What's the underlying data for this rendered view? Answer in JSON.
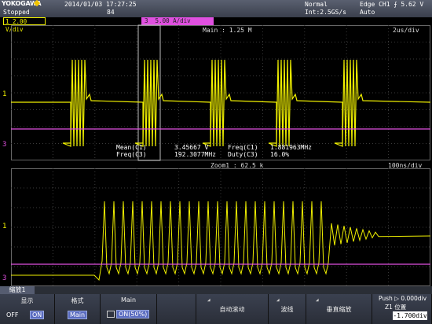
{
  "header": {
    "brand": "YOKOGAWA",
    "status": "Stopped",
    "datetime": "2014/01/03  17:27:25",
    "counter": "84",
    "mode": "Normal",
    "sampling": "Int:2.5GS/s",
    "trigger": "Edge CH1  ⨍  5.62 V",
    "acquisition": "Auto"
  },
  "channels": {
    "ch1": {
      "label": "2.00 V/div",
      "number": "1",
      "color": "#f0f000"
    },
    "ch3": {
      "label": "5.00 A/div",
      "number": "3",
      "color": "#e050e0"
    }
  },
  "main_window": {
    "title": "Main : 1.25 M",
    "timebase": "2us/div"
  },
  "zoom_window": {
    "title": "Zoom1 : 62.5 k",
    "timebase": "100ns/div"
  },
  "measurements": [
    {
      "name": "Mean(C1)",
      "value": "3.45667 V",
      "name2": "Freq(C1)",
      "value2": "1.881963MHz"
    },
    {
      "name": "Freq(C3)",
      "value": "192.3077MHz",
      "name2": "Duty(C3)",
      "value2": "16.0%"
    }
  ],
  "menu": {
    "tab": "縮放1",
    "display": {
      "title": "显示",
      "off": "OFF",
      "on": "ON"
    },
    "format": {
      "title": "格式",
      "value": "Main"
    },
    "main": {
      "title": "Main",
      "value": "ON(50%)"
    },
    "auto_scroll": "自动滚动",
    "trace": "波线",
    "vertical_zoom": "垂直缩放",
    "push_label": "Push  ▷ 0.000div",
    "z1_label": "Z1 位置",
    "z1_value": "-1.700div"
  },
  "colors": {
    "ch1": "#f0f000",
    "ch3": "#e050e0",
    "grid": "#666666",
    "header": "#4a5060"
  }
}
